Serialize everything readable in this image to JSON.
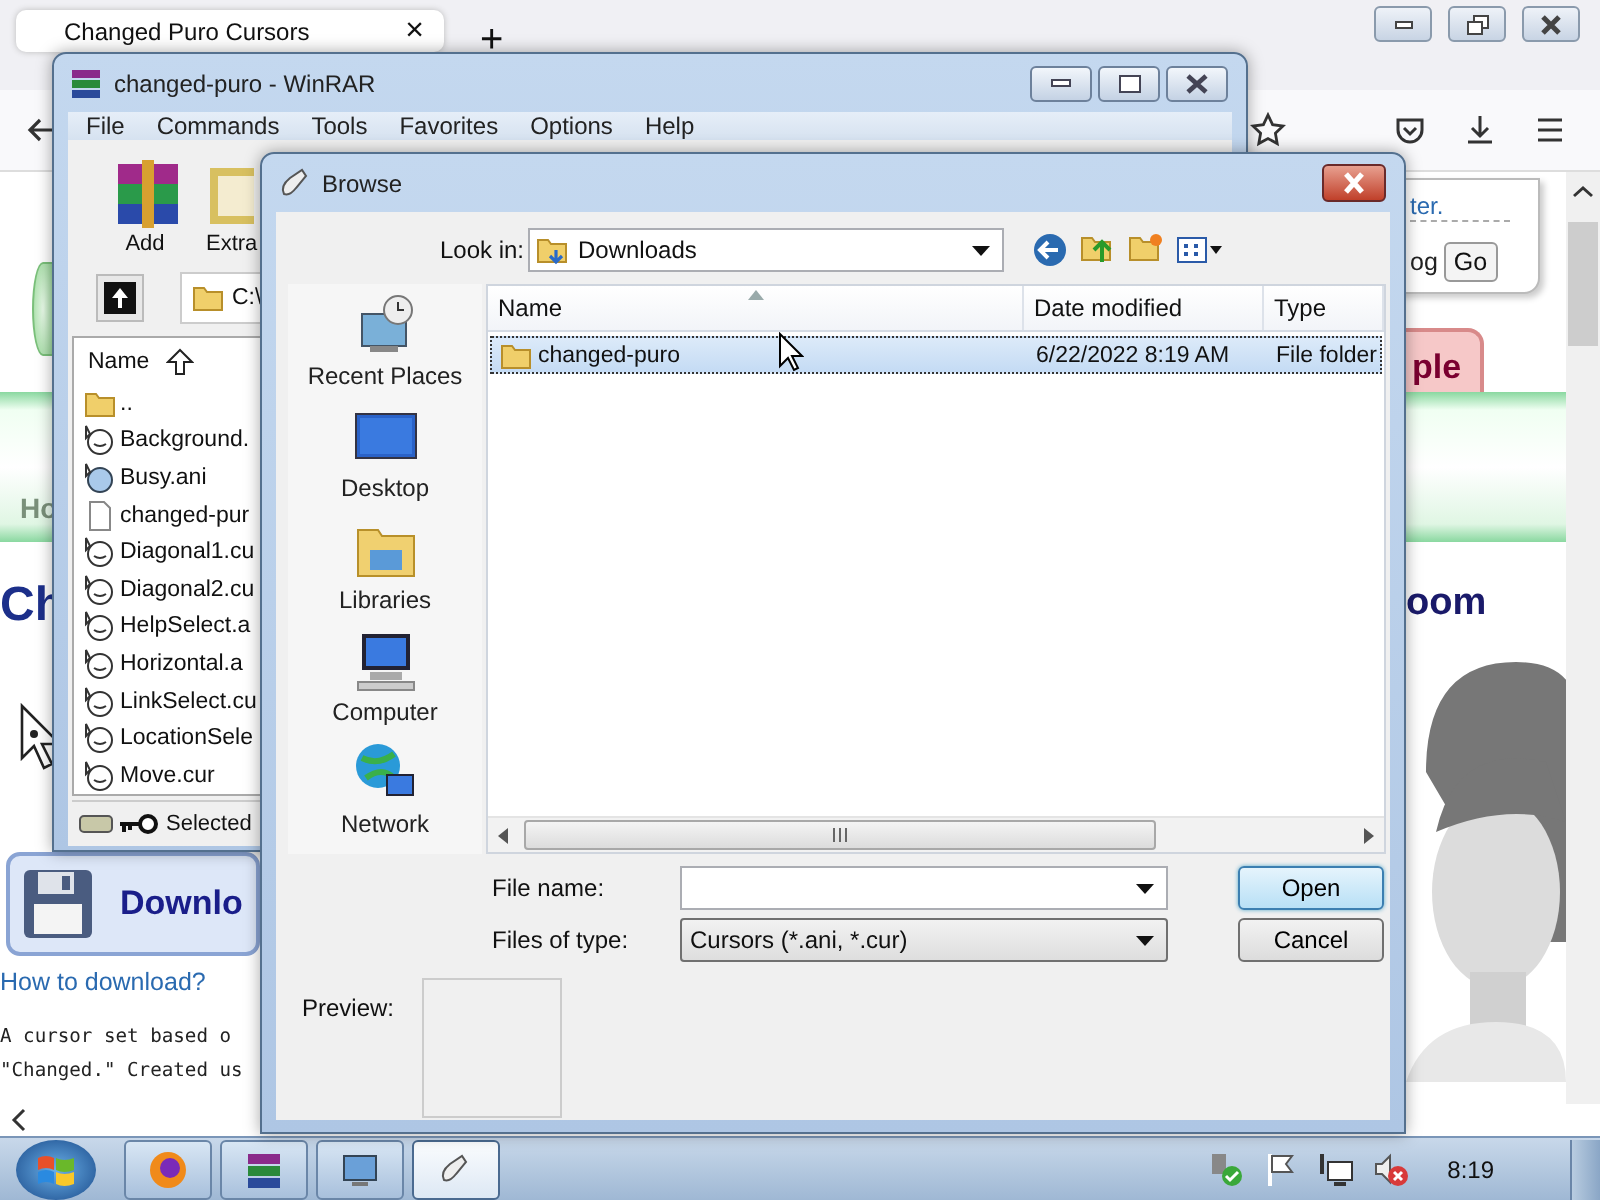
{
  "browser": {
    "tab": {
      "title": "Changed Puro Cursors",
      "close": "×"
    },
    "new_tab": "+",
    "page": {
      "note_link": "ter.",
      "search_value": "og",
      "go_button": "Go",
      "tab_label": "ple",
      "nav_label": "Ho",
      "heading": "Ch",
      "heading_right": "oom",
      "download_label": "Downlo",
      "help_link": "How to download?",
      "description": [
        "A cursor set based o",
        "\"Changed.\" Created us"
      ]
    }
  },
  "winrar": {
    "title": "changed-puro - WinRAR",
    "menu": [
      "File",
      "Commands",
      "Tools",
      "Favorites",
      "Options",
      "Help"
    ],
    "toolbar": [
      "Add",
      "Extra"
    ],
    "path": "C:\\",
    "column": "Name",
    "files": [
      {
        "name": "..",
        "kind": "folder"
      },
      {
        "name": "Background.",
        "kind": "cursor"
      },
      {
        "name": "Busy.ani",
        "kind": "busy"
      },
      {
        "name": "changed-pur",
        "kind": "file"
      },
      {
        "name": "Diagonal1.cu",
        "kind": "cursor"
      },
      {
        "name": "Diagonal2.cu",
        "kind": "cursor"
      },
      {
        "name": "HelpSelect.a",
        "kind": "cursor"
      },
      {
        "name": "Horizontal.a",
        "kind": "cursor"
      },
      {
        "name": "LinkSelect.cu",
        "kind": "cursor"
      },
      {
        "name": "LocationSele",
        "kind": "cursor"
      },
      {
        "name": "Move.cur",
        "kind": "cursor"
      }
    ],
    "status": "Selected"
  },
  "browse": {
    "title": "Browse",
    "look_in_label": "Look in:",
    "look_in": "Downloads",
    "places": [
      "Recent Places",
      "Desktop",
      "Libraries",
      "Computer",
      "Network"
    ],
    "columns": [
      "Name",
      "Date modified",
      "Type"
    ],
    "rows": [
      {
        "name": "changed-puro",
        "date": "6/22/2022 8:19 AM",
        "type": "File folder",
        "selected": true
      }
    ],
    "file_name_label": "File name:",
    "files_of_type_label": "Files of type:",
    "files_of_type": "Cursors (*.ani, *.cur)",
    "open": "Open",
    "cancel": "Cancel",
    "preview_label": "Preview:"
  },
  "taskbar": {
    "apps": [
      {
        "kind": "firefox",
        "selected": false
      },
      {
        "kind": "winrar",
        "selected": false
      },
      {
        "kind": "monitor",
        "selected": false
      },
      {
        "kind": "cursor",
        "selected": true
      }
    ],
    "clock": "8:19"
  }
}
